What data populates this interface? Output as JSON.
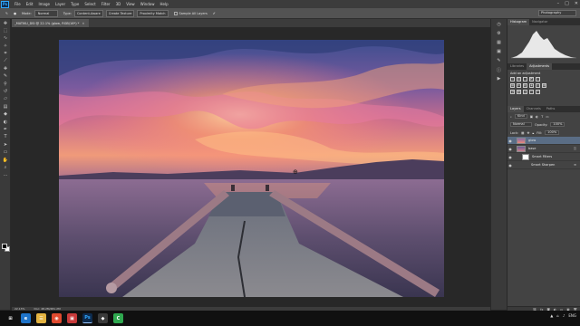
{
  "app": {
    "logo": "Ps",
    "menu": [
      "File",
      "Edit",
      "Image",
      "Layer",
      "Type",
      "Select",
      "Filter",
      "3D",
      "View",
      "Window",
      "Help"
    ],
    "window_controls": [
      "–",
      "□",
      "✕"
    ]
  },
  "options_bar": {
    "mode_label": "Mode:",
    "mode_value": "Normal",
    "type_label": "Type:",
    "content_aware": "Content-Aware",
    "create_texture": "Create Texture",
    "proximity_match": "Proximity Match",
    "sample_all_layers": "Sample All Layers",
    "workspace": "Photography"
  },
  "document": {
    "tab_title": "_MATIKU_DSI @ 22.1% (glow, RGB/16*) *",
    "zoom": "22.13%",
    "doc_size": "Doc: 48.2M/481.2M"
  },
  "panels": {
    "top_tabs": [
      "Histogram",
      "Navigator"
    ],
    "adj_tabs": [
      "Libraries",
      "Adjustments"
    ],
    "adj_title": "Add an adjustment",
    "layer_tabs": [
      "Layers",
      "Channels",
      "Paths"
    ],
    "kind_label": "Kind",
    "blend_mode": "Normal",
    "opacity_label": "Opacity:",
    "opacity_value": "100%",
    "lock_label": "Lock:",
    "fill_label": "Fill:",
    "fill_value": "100%",
    "layers": [
      {
        "name": "glow",
        "selected": true
      },
      {
        "name": "base",
        "selected": false
      },
      {
        "name": "Smart Filters",
        "selected": false
      },
      {
        "name": "Smart Sharpen",
        "selected": false
      }
    ]
  },
  "taskbar": {
    "apps": [
      "e",
      "☰",
      "◉",
      "▣",
      "Ps",
      "◆",
      "C"
    ],
    "tray_icons": [
      "▲",
      "⌂",
      "♪",
      "ENG"
    ]
  },
  "colors": {
    "accent_selected": "#5a6d85",
    "photoshop_blue": "#31a8ff"
  }
}
